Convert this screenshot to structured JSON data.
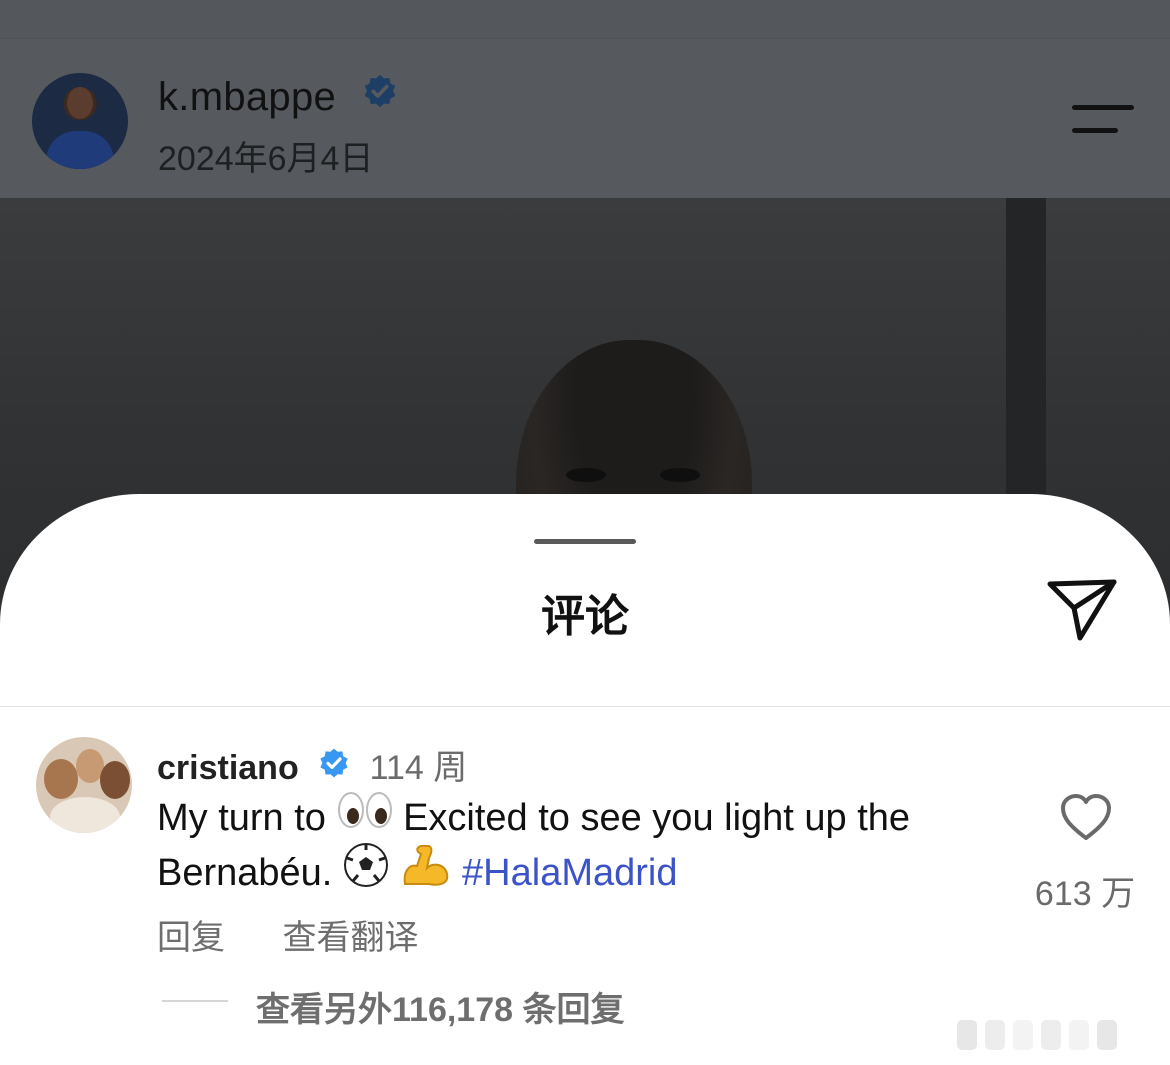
{
  "post": {
    "username": "k.mbappe",
    "date": "2024年6月4日"
  },
  "comments_sheet": {
    "title": "评论",
    "comment": {
      "username": "cristiano",
      "time_ago": "114 周",
      "text_part1": "My turn to ",
      "text_part2": " Excited to see you light up the Bernabéu. ",
      "hashtag": "#HalaMadrid",
      "reply_label": "回复",
      "translate_label": "查看翻译",
      "like_count": "613 万"
    },
    "view_replies": "查看另外116,178 条回复"
  },
  "icons": [
    "verified-badge-icon",
    "menu-icon",
    "share-icon",
    "heart-icon",
    "eyes-emoji",
    "soccer-ball-emoji",
    "flexed-biceps-emoji"
  ],
  "colors": {
    "verified_blue": "#3897f0",
    "hashtag": "#3c53c8"
  }
}
